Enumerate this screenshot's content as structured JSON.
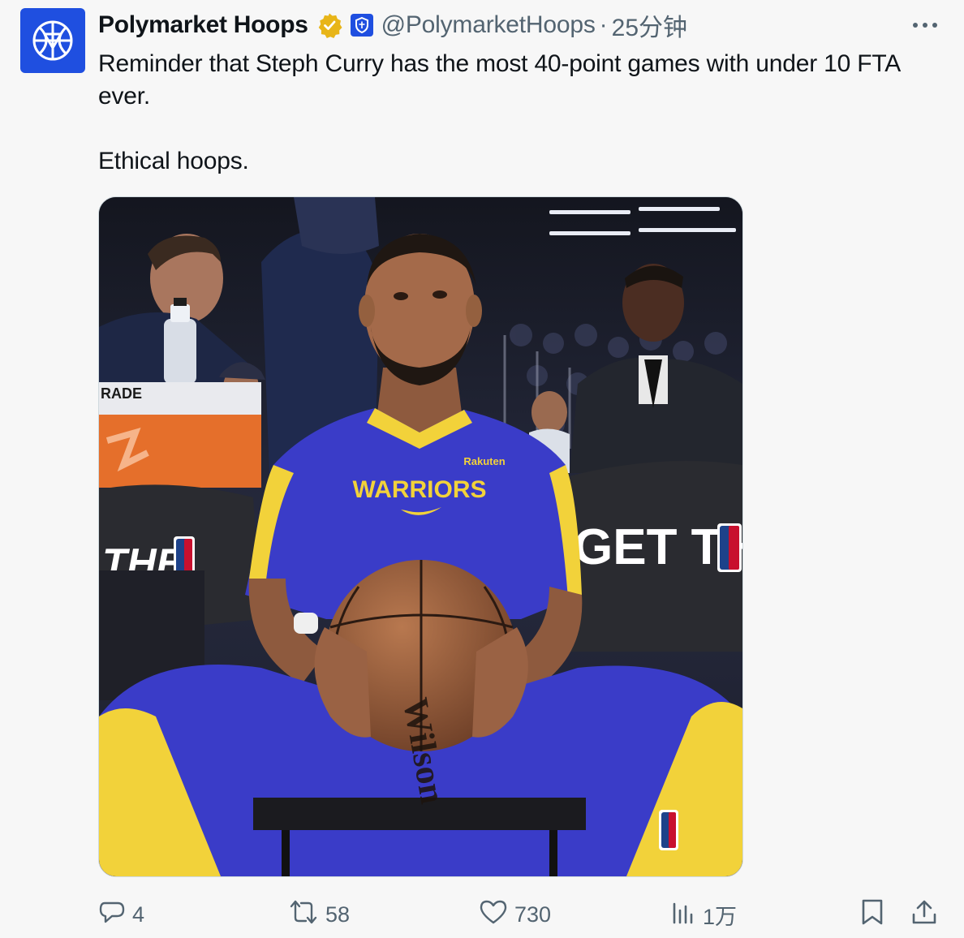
{
  "author": {
    "display_name": "Polymarket Hoops",
    "handle": "@PolymarketHoops",
    "separator": "·",
    "time": "25分钟"
  },
  "badges": {
    "verified": "verified-badge-gold",
    "affiliate": "affiliate-shield-badge"
  },
  "tweet": {
    "paragraph1": "Reminder that Steph Curry has the most 40-point games with under 10 FTA ever.",
    "paragraph2": "Ethical hoops."
  },
  "media": {
    "jersey_wordmark": "WARRIORS",
    "sponsor_patch": "Rakuten",
    "court_sign": "GET THE",
    "court_sign_left": "THE",
    "cooler_label": "RADE",
    "ball_brand": "Wilson"
  },
  "actions": {
    "reply_count": "4",
    "retweet_count": "58",
    "like_count": "730",
    "views_count": "1万"
  },
  "colors": {
    "avatar_bg": "#1f4fe0",
    "verified_gold": "#e8b518",
    "affiliate_blue": "#1f4fe0",
    "muted_text": "#536471",
    "jersey_blue": "#3a3cc8",
    "jersey_yellow": "#f2d23a"
  },
  "icons": {
    "avatar": "polymarket-basketball-logo",
    "more": "more-dots-icon",
    "reply": "reply-bubble-icon",
    "retweet": "retweet-icon",
    "like": "heart-icon",
    "views": "views-bar-chart-icon",
    "bookmark": "bookmark-icon",
    "share": "share-upload-icon"
  }
}
